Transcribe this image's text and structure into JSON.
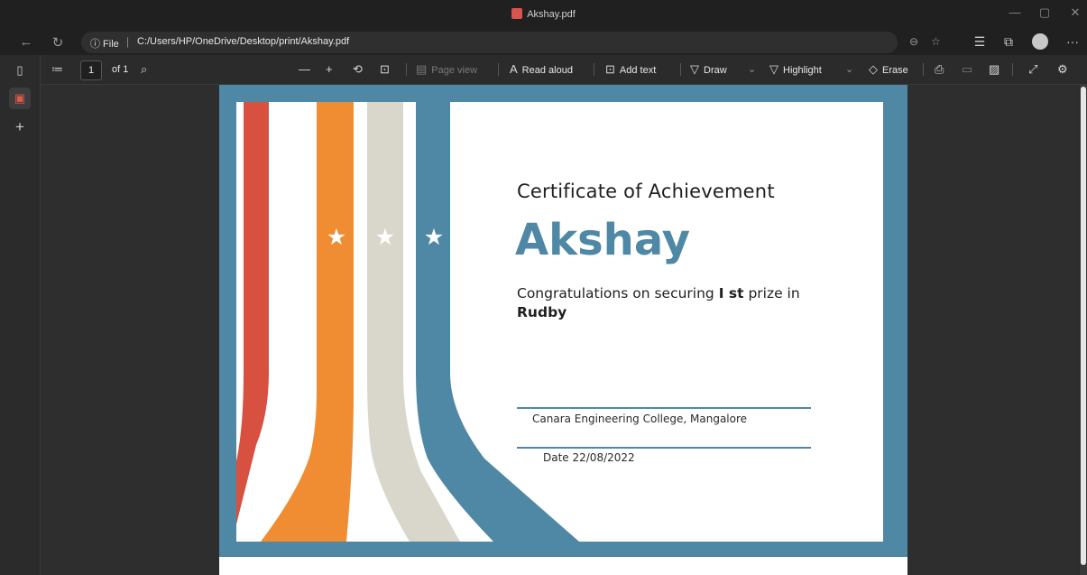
{
  "window": {
    "title": "Akshay.pdf"
  },
  "window_controls": {
    "minimize": "—",
    "restore": "▢",
    "close": "✕"
  },
  "address_bar": {
    "info_label": "ⓘ File",
    "separator": "|",
    "url": "C:/Users/HP/OneDrive/Desktop/print/Akshay.pdf",
    "back_icon": "←",
    "refresh_icon": "↻",
    "zoom_icon": "⊖",
    "star_icon": "☆",
    "favorites_icon": "☰",
    "collections_icon": "⧉",
    "more_icon": "···"
  },
  "sidebar": {
    "tabs_icon": "▯",
    "pdf_tab_icon": "▣",
    "add_tab_icon": "+"
  },
  "pdf_toolbar": {
    "contents_icon": "≔",
    "page_number": "1",
    "page_total": "of 1",
    "search_icon": "⌕",
    "zoom_out": "—",
    "zoom_in": "+",
    "rotate_icon": "⟲",
    "fit_icon": "⊡",
    "page_view_icon": "▤",
    "page_view": "Page view",
    "read_aloud_icon": "A",
    "read_aloud": "Read aloud",
    "add_text_icon": "⊡",
    "add_text": "Add text",
    "draw_icon": "▽",
    "draw": "Draw",
    "chevron": "⌄",
    "highlight_icon": "▽",
    "highlight": "Highlight",
    "erase_icon": "◇",
    "erase": "Erase",
    "print_icon": "⎙",
    "save_icon": "▭",
    "save_as_icon": "▨",
    "fullscreen_icon": "⤢",
    "settings_icon": "⚙"
  },
  "certificate": {
    "title": "Certificate of Achievement",
    "name": "Akshay",
    "line_prefix": "Congratulations on securing ",
    "prize": "I st",
    "line_suffix": " prize in",
    "event": "Rudby",
    "college": "Canara Engineering College, Mangalore",
    "date": "Date 22/08/2022",
    "colors": {
      "blue": "#4f88a5",
      "red": "#d75040",
      "orange": "#f08c32",
      "gray": "#d9d6cc"
    }
  }
}
